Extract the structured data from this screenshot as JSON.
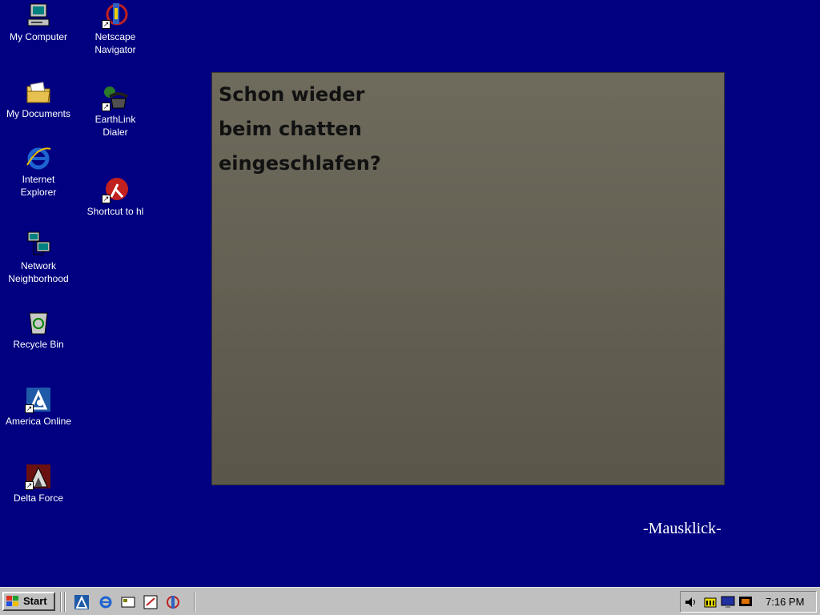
{
  "desktop": {
    "icons": [
      {
        "label": "My Computer",
        "icon": "computer-icon"
      },
      {
        "label": "My Documents",
        "icon": "folder-icon"
      },
      {
        "label": "Internet\nExplorer",
        "icon": "internet-explorer-icon"
      },
      {
        "label": "Network\nNeighborhood",
        "icon": "network-icon"
      },
      {
        "label": "Recycle Bin",
        "icon": "recycle-bin-icon"
      },
      {
        "label": "America Online",
        "icon": "aol-icon"
      },
      {
        "label": "Delta Force",
        "icon": "delta-force-icon"
      },
      {
        "label": "Netscape\nNavigator",
        "icon": "netscape-icon"
      },
      {
        "label": "EarthLink\nDialer",
        "icon": "phone-icon"
      },
      {
        "label": "Shortcut to hl",
        "icon": "half-life-icon"
      }
    ]
  },
  "wallpaper": {
    "caption": "Schon wieder\nbeim chatten\neingeschlafen?",
    "signature": "-Mausklick-",
    "placeholder_note": ""
  },
  "taskbar": {
    "start_label": "Start",
    "quick_launch": [
      "aol-icon",
      "internet-explorer-icon",
      "desktop-icon",
      "channels-icon",
      "netscape-icon"
    ],
    "tray": {
      "icons": [
        "volume-icon",
        "task-scheduler-icon",
        "monitor-icon",
        "display-icon"
      ],
      "clock": "7:16 PM"
    }
  },
  "colors": {
    "desktop_bg": "#000080",
    "taskbar_bg": "#c0c0c0"
  }
}
